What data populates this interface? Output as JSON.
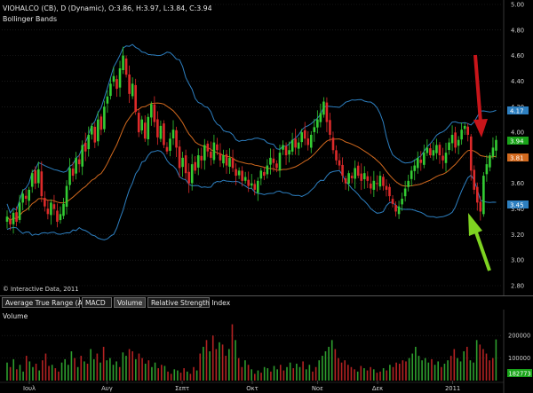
{
  "header": {
    "title": "VIOHALCO (CB), D (Dynamic), O:3.86, H:3.97, L:3.84, C:3.94",
    "indicator": "Bollinger Bands",
    "copyright": "© Interactive Data, 2011"
  },
  "price_badges": {
    "upper": {
      "label": "4.17",
      "color": "#2d7fc0"
    },
    "close": {
      "label": "3.94",
      "color": "#19a319"
    },
    "middle": {
      "label": "3.81",
      "color": "#d2691e"
    },
    "lower": {
      "label": "3.45",
      "color": "#2d7fc0"
    }
  },
  "tabs": [
    {
      "label": "Average True Range (ATR)"
    },
    {
      "label": "MACD"
    },
    {
      "label": "Volume"
    },
    {
      "label": "Relative Strength Index"
    }
  ],
  "volume_panel": {
    "title": "Volume",
    "badge": "182773"
  },
  "arrows": {
    "red": "#c8151a",
    "green": "#7ed321"
  },
  "colors": {
    "up": "#33cc33",
    "down": "#dd2a2a",
    "band": "#2d7fc0",
    "ma": "#d2691e",
    "grid": "#2a2a2a"
  },
  "chart_data": [
    {
      "type": "candlestick",
      "title": "VIOHALCO (CB), D (Dynamic), O:3.86, H:3.97, L:3.84, C:3.94",
      "indicator": "Bollinger Bands",
      "ylim": [
        2.8,
        5.0
      ],
      "y_ticks": [
        "5.00",
        "4.80",
        "4.60",
        "4.40",
        "4.20",
        "4.00",
        "3.80",
        "3.60",
        "3.40",
        "3.20",
        "3.00",
        "2.80"
      ],
      "x_tick_labels": [
        "Ιουλ",
        "Αυγ",
        "Σεπτ",
        "Οκτ",
        "Νοε",
        "Δεκ",
        "2011"
      ],
      "ohlc_close": [
        3.34,
        3.28,
        3.37,
        3.3,
        3.45,
        3.52,
        3.48,
        3.55,
        3.68,
        3.6,
        3.71,
        3.5,
        3.42,
        3.36,
        3.45,
        3.4,
        3.3,
        3.36,
        3.44,
        3.58,
        3.72,
        3.66,
        3.8,
        3.75,
        3.9,
        3.85,
        3.98,
        4.05,
        3.92,
        4.1,
        4.02,
        4.2,
        4.28,
        4.38,
        4.44,
        4.34,
        4.5,
        4.6,
        4.45,
        4.3,
        4.38,
        4.16,
        4.0,
        4.1,
        3.95,
        4.12,
        4.22,
        4.08,
        3.96,
        4.05,
        3.9,
        3.85,
        3.95,
        4.02,
        3.88,
        3.72,
        3.8,
        3.68,
        3.6,
        3.75,
        3.7,
        3.82,
        3.78,
        3.9,
        3.85,
        3.8,
        3.92,
        3.86,
        3.78,
        3.82,
        3.74,
        3.8,
        3.72,
        3.66,
        3.7,
        3.62,
        3.65,
        3.58,
        3.6,
        3.55,
        3.62,
        3.7,
        3.66,
        3.74,
        3.8,
        3.76,
        3.72,
        3.84,
        3.9,
        3.82,
        3.86,
        3.94,
        3.88,
        3.92,
        4.0,
        3.95,
        3.9,
        3.98,
        4.04,
        4.1,
        4.15,
        4.24,
        4.08,
        3.98,
        3.86,
        3.78,
        3.74,
        3.66,
        3.6,
        3.68,
        3.64,
        3.72,
        3.66,
        3.62,
        3.68,
        3.62,
        3.56,
        3.62,
        3.6,
        3.66,
        3.58,
        3.55,
        3.5,
        3.44,
        3.38,
        3.42,
        3.48,
        3.56,
        3.62,
        3.7,
        3.74,
        3.8,
        3.76,
        3.84,
        3.88,
        3.82,
        3.86,
        3.9,
        3.82,
        3.78,
        3.84,
        3.92,
        3.98,
        3.88,
        3.94,
        4.02,
        4.05,
        3.98,
        3.7,
        3.55,
        3.45,
        3.38,
        3.66,
        3.75,
        3.82,
        3.88,
        3.94
      ],
      "bollinger": {
        "upper_last": 4.17,
        "middle_last": 3.81,
        "lower_last": 3.45
      },
      "last_close": 3.94
    },
    {
      "type": "bar",
      "title": "Volume",
      "ylim": [
        0,
        260000
      ],
      "y_ticks": [
        "200000",
        "100000"
      ],
      "volume": [
        80000,
        60000,
        95000,
        50000,
        70000,
        40000,
        110000,
        85000,
        60000,
        75000,
        45000,
        90000,
        120000,
        65000,
        70000,
        55000,
        40000,
        80000,
        95000,
        70000,
        130000,
        100000,
        60000,
        110000,
        85000,
        75000,
        140000,
        95000,
        120000,
        80000,
        150000,
        90000,
        100000,
        70000,
        85000,
        60000,
        125000,
        110000,
        140000,
        130000,
        95000,
        120000,
        100000,
        75000,
        90000,
        60000,
        80000,
        55000,
        70000,
        65000,
        40000,
        30000,
        50000,
        45000,
        35000,
        55000,
        40000,
        30000,
        60000,
        45000,
        120000,
        150000,
        180000,
        130000,
        200000,
        140000,
        170000,
        160000,
        110000,
        140000,
        250000,
        180000,
        100000,
        60000,
        90000,
        70000,
        50000,
        30000,
        45000,
        35000,
        60000,
        55000,
        40000,
        65000,
        50000,
        70000,
        45000,
        60000,
        80000,
        55000,
        75000,
        60000,
        85000,
        50000,
        70000,
        40000,
        60000,
        90000,
        110000,
        130000,
        150000,
        180000,
        140000,
        100000,
        80000,
        90000,
        70000,
        60000,
        50000,
        40000,
        65000,
        55000,
        45000,
        60000,
        50000,
        35000,
        40000,
        55000,
        45000,
        70000,
        60000,
        80000,
        75000,
        90000,
        85000,
        100000,
        120000,
        150000,
        110000,
        90000,
        100000,
        80000,
        95000,
        70000,
        85000,
        60000,
        75000,
        90000,
        110000,
        140000,
        100000,
        85000,
        130000,
        150000,
        90000,
        80000,
        180000,
        160000,
        140000,
        120000,
        90000,
        100000,
        182773
      ],
      "last_value": 182773
    }
  ]
}
